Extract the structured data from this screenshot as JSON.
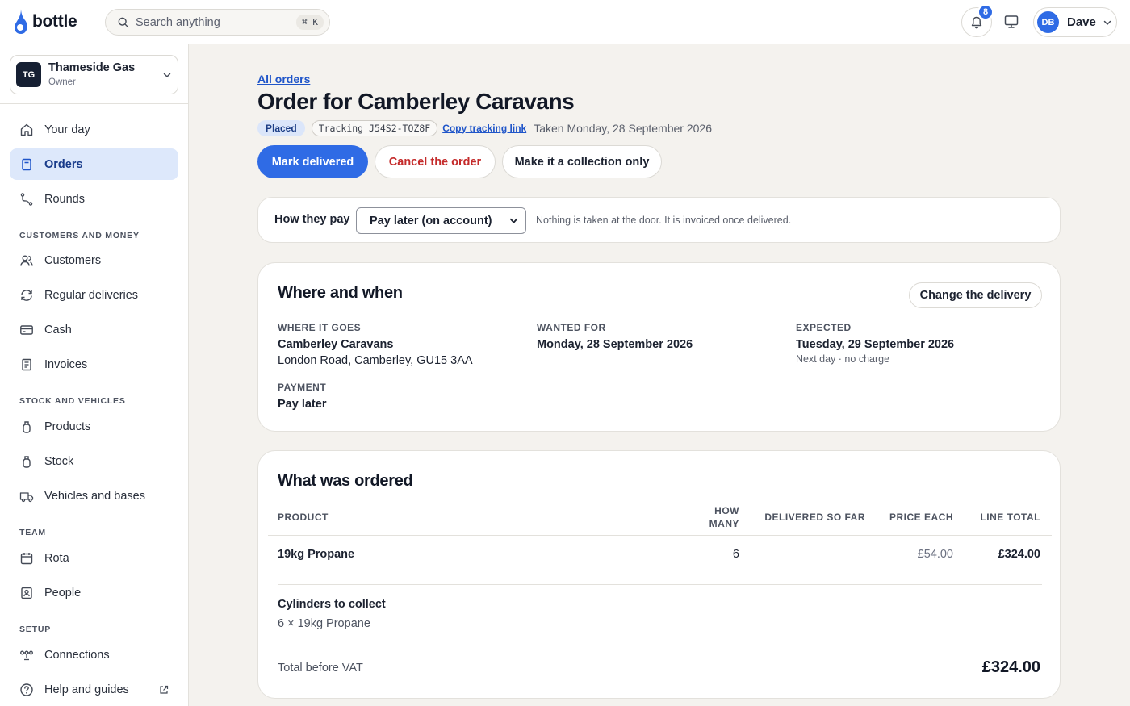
{
  "app": {
    "name": "bottle"
  },
  "header": {
    "search_placeholder": "Search anything",
    "search_shortcut": "⌘ K",
    "notification_count": "8",
    "user_initials": "DB",
    "user_name": "Dave"
  },
  "sidebar": {
    "org": {
      "initials": "TG",
      "name": "Thameside Gas",
      "role": "Owner"
    },
    "items": [
      {
        "label": "Your day",
        "icon": "home-icon"
      },
      {
        "label": "Orders",
        "icon": "orders-icon",
        "active": true
      },
      {
        "label": "Rounds",
        "icon": "route-icon"
      },
      {
        "label": "Customers",
        "icon": "people-icon"
      },
      {
        "label": "Regular deliveries",
        "icon": "repeat-icon"
      },
      {
        "label": "Cash",
        "icon": "card-icon"
      },
      {
        "label": "Invoices",
        "icon": "invoice-icon"
      },
      {
        "label": "Products",
        "icon": "cylinder-icon"
      },
      {
        "label": "Stock",
        "icon": "cylinder-icon"
      },
      {
        "label": "Vehicles and bases",
        "icon": "truck-icon"
      },
      {
        "label": "Rota",
        "icon": "calendar-icon"
      },
      {
        "label": "People",
        "icon": "badge-icon"
      },
      {
        "label": "Connections",
        "icon": "connections-icon"
      },
      {
        "label": "Help and guides",
        "icon": "help-icon"
      }
    ],
    "sections": {
      "customers": "CUSTOMERS AND MONEY",
      "stock": "STOCK AND VEHICLES",
      "team": "TEAM",
      "setup": "SETUP"
    }
  },
  "order": {
    "back_link": "All orders",
    "title": "Order for Camberley Caravans",
    "status": "Placed",
    "tracking": "Tracking J54S2-TQZ8F",
    "copy_link": "Copy tracking link",
    "taken": "Taken Monday, 28 September 2026",
    "actions": {
      "mark_delivered": "Mark delivered",
      "cancel": "Cancel the order",
      "collection": "Make it a collection only"
    },
    "payment": {
      "label": "How they pay",
      "selected": "Pay later (on account)",
      "hint": "Nothing is taken at the door. It is invoiced once delivered."
    },
    "where": {
      "title": "Where and when",
      "change_button": "Change the delivery",
      "where_label": "WHERE IT GOES",
      "customer": "Camberley Caravans",
      "address": "London Road, Camberley, GU15 3AA",
      "wanted_label": "WANTED FOR",
      "wanted_value": "Monday, 28 September 2026",
      "expected_label": "EXPECTED",
      "expected_value": "Tuesday, 29 September 2026",
      "expected_note": "Next day · no charge",
      "payment_label": "PAYMENT",
      "payment_value": "Pay later"
    },
    "items": {
      "title": "What was ordered",
      "columns": {
        "product": "PRODUCT",
        "qty_line1": "HOW",
        "qty_line2": "MANY",
        "delivered": "DELIVERED SO FAR",
        "price": "PRICE EACH",
        "total": "LINE TOTAL"
      },
      "rows": [
        {
          "product": "19kg Propane",
          "qty": "6",
          "delivered": "",
          "price": "£54.00",
          "total": "£324.00"
        }
      ],
      "collect_title": "Cylinders to collect",
      "collect_text": "6 × 19kg Propane",
      "total_label": "Total before VAT",
      "total_value": "£324.00"
    }
  },
  "colors": {
    "accent": "#2f6be5",
    "danger": "#c42a2a",
    "background": "#f4f2ee",
    "active_nav": "#dde8fb"
  }
}
